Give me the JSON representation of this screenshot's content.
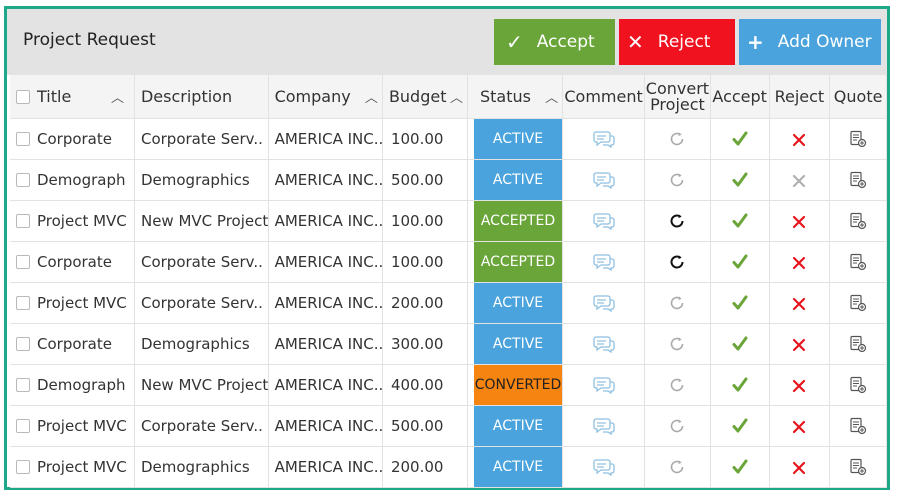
{
  "toolbar": {
    "title": "Project Request",
    "accept_label": "Accept",
    "reject_label": "Reject",
    "add_owner_label": "Add Owner"
  },
  "columns": {
    "title": "Title",
    "description": "Description",
    "company": "Company",
    "budget": "Budget",
    "status": "Status",
    "comment": "Comment",
    "convert_line1": "Convert",
    "convert_line2": "Project",
    "accept": "Accept",
    "reject": "Reject",
    "quote": "Quote"
  },
  "colors": {
    "accent_border": "#1ea88a",
    "accept_green": "#6aa539",
    "reject_red": "#f0131f",
    "add_owner_blue": "#4aa3dc",
    "status_active": "#4aa3dc",
    "status_accepted": "#6aa539",
    "status_converted": "#f58410"
  },
  "rows": [
    {
      "title": "Corporate",
      "description": "Corporate Serv..",
      "company": "AMERICA INC...",
      "budget": "100.00",
      "status": "ACTIVE",
      "convert_icon": "refresh-icon-disabled",
      "reject_icon": "x-icon-red"
    },
    {
      "title": "Demograph",
      "description": "Demographics",
      "company": "AMERICA INC...",
      "budget": "500.00",
      "status": "ACTIVE",
      "convert_icon": "refresh-icon-disabled",
      "reject_icon": "x-icon-grey"
    },
    {
      "title": "Project MVC",
      "description": "New MVC Project",
      "company": "AMERICA INC...",
      "budget": "100.00",
      "status": "ACCEPTED",
      "convert_icon": "refresh-icon-enabled",
      "reject_icon": "x-icon-red"
    },
    {
      "title": "Corporate",
      "description": "Corporate Serv..",
      "company": "AMERICA INC...",
      "budget": "100.00",
      "status": "ACCEPTED",
      "convert_icon": "refresh-icon-enabled",
      "reject_icon": "x-icon-red"
    },
    {
      "title": "Project MVC",
      "description": "Corporate Serv..",
      "company": "AMERICA INC...",
      "budget": "200.00",
      "status": "ACTIVE",
      "convert_icon": "refresh-icon-disabled",
      "reject_icon": "x-icon-red"
    },
    {
      "title": "Corporate",
      "description": "Demographics",
      "company": "AMERICA INC...",
      "budget": "300.00",
      "status": "ACTIVE",
      "convert_icon": "refresh-icon-disabled",
      "reject_icon": "x-icon-red"
    },
    {
      "title": "Demograph",
      "description": "New MVC Project",
      "company": "AMERICA INC...",
      "budget": "400.00",
      "status": "CONVERTED",
      "convert_icon": "refresh-icon-disabled",
      "reject_icon": "x-icon-red"
    },
    {
      "title": "Project MVC",
      "description": "Corporate Serv..",
      "company": "AMERICA INC...",
      "budget": "500.00",
      "status": "ACTIVE",
      "convert_icon": "refresh-icon-disabled",
      "reject_icon": "x-icon-red"
    },
    {
      "title": "Project MVC",
      "description": "Demographics",
      "company": "AMERICA INC...",
      "budget": "200.00",
      "status": "ACTIVE",
      "convert_icon": "refresh-icon-disabled",
      "reject_icon": "x-icon-red"
    }
  ]
}
